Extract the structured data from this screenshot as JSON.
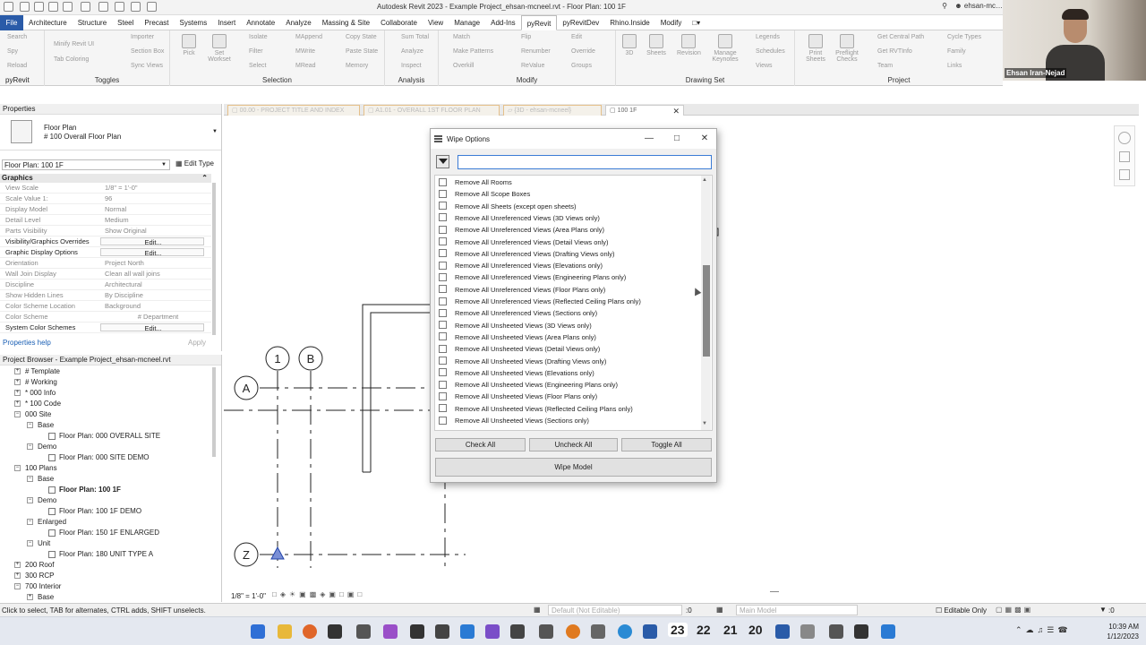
{
  "titlebar": {
    "title": "Autodesk Revit 2023 - Example Project_ehsan-mcneel.rvt - Floor Plan: 100 1F",
    "user": "ehsan-mc…"
  },
  "menu": [
    "File",
    "Architecture",
    "Structure",
    "Steel",
    "Precast",
    "Systems",
    "Insert",
    "Annotate",
    "Analyze",
    "Massing & Site",
    "Collaborate",
    "View",
    "Manage",
    "Add-Ins",
    "pyRevit",
    "pyRevitDev",
    "Rhino.Inside",
    "Modify"
  ],
  "ribbon": {
    "groups": {
      "pyrevit": "pyRevit",
      "toggles": "Toggles",
      "selection": "Selection",
      "analysis": "Analysis",
      "modify": "Modify",
      "drawing_set": "Drawing Set",
      "project": "Project"
    },
    "items": {
      "search": "Search",
      "spy": "Spy",
      "reload": "Reload",
      "minify": "Minify Revit UI",
      "tab_coloring": "Tab Coloring",
      "importer": "Importer",
      "section_box": "Section Box",
      "sync_views": "Sync Views",
      "pick": "Pick",
      "set_workset": "Set Workset",
      "isolate": "Isolate",
      "filter": "Filter",
      "select": "Select",
      "mappend": "MAppend",
      "mwrite": "MWrite",
      "mread": "MRead",
      "copy_state": "Copy State",
      "paste_state": "Paste State",
      "memory": "Memory",
      "sum_total": "Sum Total",
      "analyze": "Analyze",
      "inspect": "Inspect",
      "match": "Match",
      "make_patterns": "Make Patterns",
      "overkill": "Overkill",
      "flip": "Flip",
      "renumber": "Renumber",
      "revalue": "ReValue",
      "edit": "Edit",
      "override": "Override",
      "groups": "Groups",
      "three_d": "3D",
      "sheets": "Sheets",
      "revision": "Revision",
      "manage_keynotes": "Manage Keynotes",
      "legends": "Legends",
      "schedules": "Schedules",
      "views": "Views",
      "print_sheets": "Print Sheets",
      "preflight_checks": "Preflight Checks",
      "get_central_path": "Get Central Path",
      "get_rvtinfo": "Get RVTInfo",
      "team": "Team",
      "cycle_types": "Cycle Types",
      "family": "Family",
      "links": "Links"
    }
  },
  "webcam": {
    "name": "Ehsan Iran-Nejad"
  },
  "properties": {
    "header": "Properties",
    "type_name": "Floor Plan",
    "type_sub": "# 100 Overall Floor Plan",
    "view_selector": "Floor Plan: 100 1F",
    "edit_type": "Edit Type",
    "category": "Graphics",
    "rows": [
      {
        "k": "View Scale",
        "v": "1/8\" = 1'-0\""
      },
      {
        "k": "Scale Value    1:",
        "v": "96"
      },
      {
        "k": "Display Model",
        "v": "Normal"
      },
      {
        "k": "Detail Level",
        "v": "Medium"
      },
      {
        "k": "Parts Visibility",
        "v": "Show Original"
      },
      {
        "k": "Visibility/Graphics Overrides",
        "v": "Edit..."
      },
      {
        "k": "Graphic Display Options",
        "v": "Edit..."
      },
      {
        "k": "Orientation",
        "v": "Project North"
      },
      {
        "k": "Wall Join Display",
        "v": "Clean all wall joins"
      },
      {
        "k": "Discipline",
        "v": "Architectural"
      },
      {
        "k": "Show Hidden Lines",
        "v": "By Discipline"
      },
      {
        "k": "Color Scheme Location",
        "v": "Background"
      },
      {
        "k": "Color Scheme",
        "v": "# Department"
      },
      {
        "k": "System Color Schemes",
        "v": "Edit..."
      }
    ],
    "help": "Properties help",
    "apply": "Apply"
  },
  "browser": {
    "header": "Project Browser - Example Project_ehsan-mcneel.rvt",
    "nodes": [
      {
        "label": "# Template",
        "level": 1,
        "toggle": "+"
      },
      {
        "label": "# Working",
        "level": 1,
        "toggle": "+"
      },
      {
        "label": "* 000 Info",
        "level": 1,
        "toggle": "+"
      },
      {
        "label": "* 100 Code",
        "level": 1,
        "toggle": "+"
      },
      {
        "label": "000 Site",
        "level": 1,
        "toggle": "−"
      },
      {
        "label": "Base",
        "level": 2,
        "toggle": "−"
      },
      {
        "label": "Floor Plan: 000 OVERALL SITE",
        "level": 3,
        "toggle": ""
      },
      {
        "label": "Demo",
        "level": 2,
        "toggle": "−"
      },
      {
        "label": "Floor Plan: 000 SITE DEMO",
        "level": 3,
        "toggle": ""
      },
      {
        "label": "100 Plans",
        "level": 1,
        "toggle": "−"
      },
      {
        "label": "Base",
        "level": 2,
        "toggle": "−"
      },
      {
        "label": "Floor Plan: 100 1F",
        "level": 3,
        "toggle": "",
        "bold": true
      },
      {
        "label": "Demo",
        "level": 2,
        "toggle": "−"
      },
      {
        "label": "Floor Plan: 100 1F DEMO",
        "level": 3,
        "toggle": ""
      },
      {
        "label": "Enlarged",
        "level": 2,
        "toggle": "−"
      },
      {
        "label": "Floor Plan: 150 1F ENLARGED",
        "level": 3,
        "toggle": ""
      },
      {
        "label": "Unit",
        "level": 2,
        "toggle": "−"
      },
      {
        "label": "Floor Plan: 180 UNIT TYPE A",
        "level": 3,
        "toggle": ""
      },
      {
        "label": "200 Roof",
        "level": 1,
        "toggle": "+"
      },
      {
        "label": "300 RCP",
        "level": 1,
        "toggle": "+"
      },
      {
        "label": "700 Interior",
        "level": 1,
        "toggle": "−"
      },
      {
        "label": "Base",
        "level": 2,
        "toggle": "+"
      }
    ]
  },
  "view_tabs": [
    {
      "label": "00.00 - PROJECT TITLE AND INDEX",
      "active": false
    },
    {
      "label": "A1.01 - OVERALL 1ST FLOOR PLAN",
      "active": false
    },
    {
      "label": "{3D - ehsan-mcneel}",
      "active": false
    },
    {
      "label": "100 1F",
      "active": true
    }
  ],
  "grids": {
    "g1": "1",
    "gB": "B",
    "gA": "A",
    "gZ": "Z"
  },
  "dialog": {
    "title": "Wipe Options",
    "search_value": "",
    "options": [
      "Remove All Rooms",
      "Remove All Scope Boxes",
      "Remove All Sheets (except open sheets)",
      "Remove All Unreferenced Views (3D Views only)",
      "Remove All Unreferenced Views (Area Plans only)",
      "Remove All Unreferenced Views (Detail Views only)",
      "Remove All Unreferenced Views (Drafting Views only)",
      "Remove All Unreferenced Views (Elevations only)",
      "Remove All Unreferenced Views (Engineering Plans only)",
      "Remove All Unreferenced Views (Floor Plans only)",
      "Remove All Unreferenced Views (Reflected Ceiling Plans only)",
      "Remove All Unreferenced Views (Sections only)",
      "Remove All Unsheeted Views (3D Views only)",
      "Remove All Unsheeted Views (Area Plans only)",
      "Remove All Unsheeted Views (Detail Views only)",
      "Remove All Unsheeted Views (Drafting Views only)",
      "Remove All Unsheeted Views (Elevations only)",
      "Remove All Unsheeted Views (Engineering Plans only)",
      "Remove All Unsheeted Views (Floor Plans only)",
      "Remove All Unsheeted Views (Reflected Ceiling Plans only)",
      "Remove All Unsheeted Views (Sections only)"
    ],
    "check_all": "Check All",
    "uncheck_all": "Uncheck All",
    "toggle_all": "Toggle All",
    "wipe_model": "Wipe Model"
  },
  "view_control": {
    "scale": "1/8\" = 1'-0\""
  },
  "status": {
    "text": "Click to select, TAB for alternates, CTRL adds, SHIFT unselects.",
    "design_option": "Default (Not Editable)",
    "workset_zero": ":0",
    "main_model": "Main Model",
    "editable_only": "Editable Only",
    "sel_count": ":0"
  },
  "taskbar": {
    "time": "10:39 AM",
    "date": "1/12/2023",
    "day_icons": [
      "23",
      "22",
      "21",
      "20"
    ]
  },
  "colors": {
    "accent": "#2a5ba8",
    "active_tab_border": "#e5c08a",
    "grid_marker": "#2244aa"
  }
}
